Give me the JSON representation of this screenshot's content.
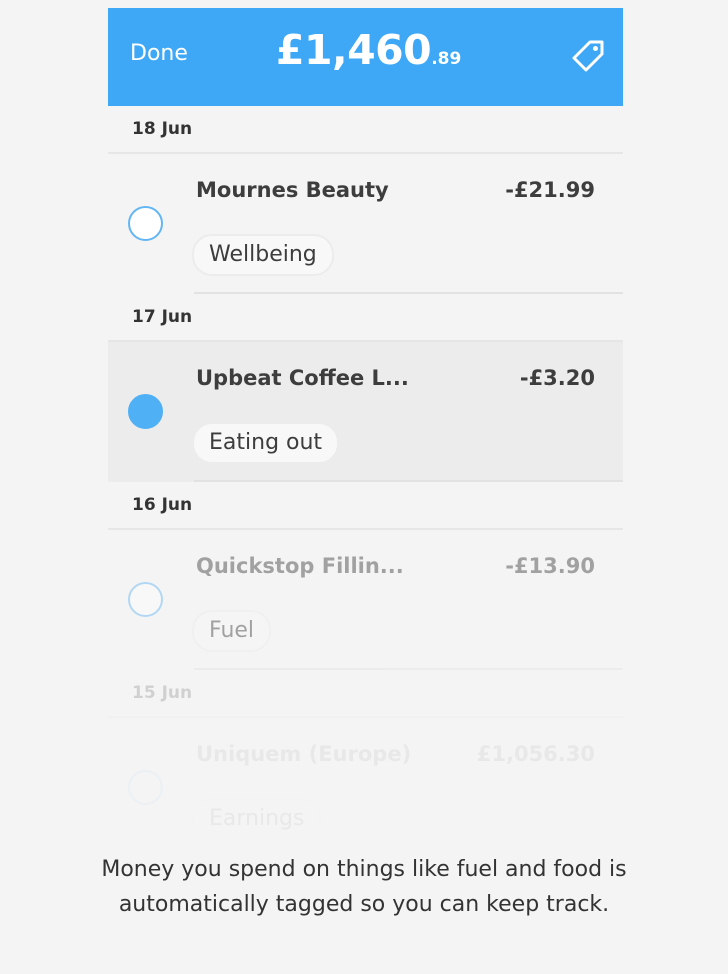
{
  "header": {
    "done_label": "Done",
    "balance_main": "£1,460",
    "balance_cents": ".89",
    "tag_icon": "price-tag-icon"
  },
  "groups": [
    {
      "date": "18 Jun",
      "transactions": [
        {
          "name": "Mournes Beauty",
          "amount": "-£21.99",
          "tag": "Wellbeing",
          "selected": false
        }
      ]
    },
    {
      "date": "17 Jun",
      "transactions": [
        {
          "name": "Upbeat Coffee L...",
          "amount": "-£3.20",
          "tag": "Eating out",
          "selected": true
        }
      ]
    },
    {
      "date": "16 Jun",
      "transactions": [
        {
          "name": "Quickstop Fillin...",
          "amount": "-£13.90",
          "tag": "Fuel",
          "selected": false
        }
      ]
    },
    {
      "date": "15 Jun",
      "transactions": [
        {
          "name": "Uniquem (Europe)",
          "amount": "£1,056.30",
          "tag": "Earnings",
          "selected": false
        }
      ]
    }
  ],
  "caption": "Money you spend on things like fuel and food is automatically tagged so you can keep track.",
  "colors": {
    "accent": "#3ea8f6",
    "background": "#f4f4f4",
    "text": "#3d3d3d"
  }
}
